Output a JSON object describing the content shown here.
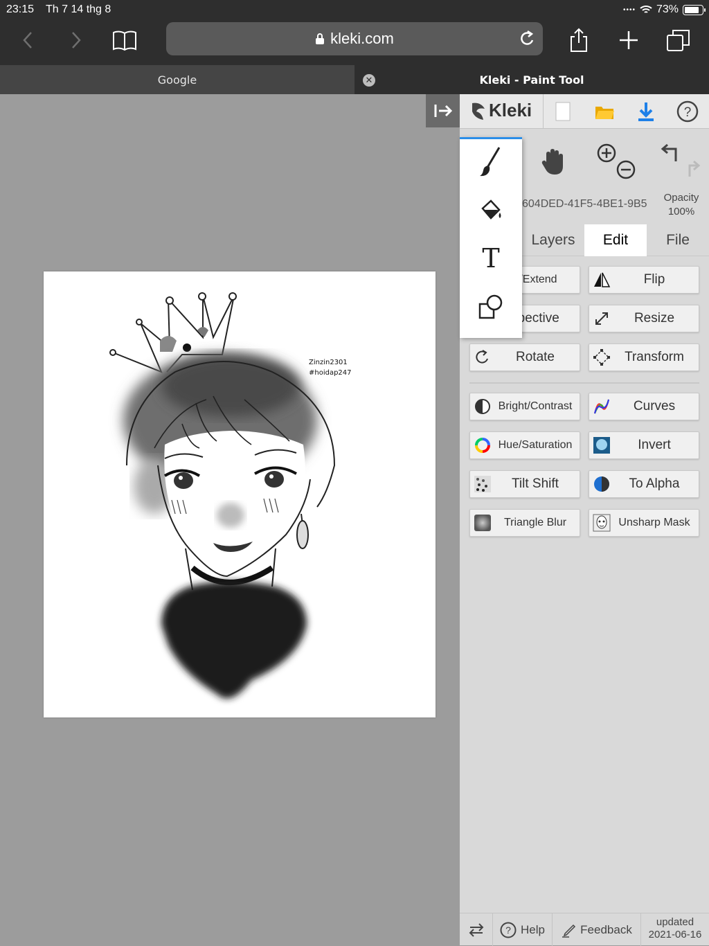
{
  "status_bar": {
    "time": "23:15",
    "date": "Th 7 14 thg 8",
    "battery": "73%"
  },
  "browser": {
    "url": "kleki.com"
  },
  "tabs": [
    {
      "title": "Google"
    },
    {
      "title": "Kleki - Paint Tool"
    }
  ],
  "drawing": {
    "signature_line1": "Zinzin2301",
    "signature_line2": "#hoidap247"
  },
  "app": {
    "logo": "Kleki",
    "layer_name": "604DED-41F5-4BE1-9B5",
    "opacity_label": "Opacity",
    "opacity_value": "100%",
    "subtabs": [
      "Layers",
      "Edit",
      "File"
    ],
    "edit_buttons": {
      "crop": "p/Extend",
      "flip": "Flip",
      "perspective": "spective",
      "resize": "Resize",
      "rotate": "Rotate",
      "transform": "Transform"
    },
    "filter_buttons": {
      "bright_contrast": "Bright/Contrast",
      "curves": "Curves",
      "hue_saturation": "Hue/Saturation",
      "invert": "Invert",
      "tilt_shift": "Tilt Shift",
      "to_alpha": "To Alpha",
      "triangle_blur": "Triangle Blur",
      "unsharp_mask": "Unsharp Mask"
    },
    "footer": {
      "help": "Help",
      "feedback": "Feedback",
      "updated_label": "updated",
      "updated_date": "2021-06-16"
    }
  },
  "colors": {
    "accent": "#2b8ee8",
    "panel_bg": "#d9d9d9",
    "canvas_bg": "#9c9c9c"
  }
}
